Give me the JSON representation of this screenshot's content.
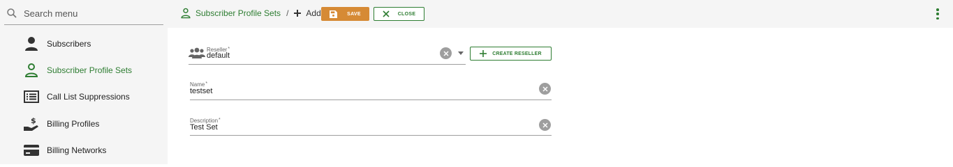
{
  "search": {
    "placeholder": "Search menu"
  },
  "sidebar": {
    "items": [
      {
        "label": "Subscribers",
        "icon": "person-icon",
        "active": false
      },
      {
        "label": "Subscriber Profile Sets",
        "icon": "person-outline-icon",
        "active": true
      },
      {
        "label": "Call List Suppressions",
        "icon": "list-icon",
        "active": false
      },
      {
        "label": "Billing Profiles",
        "icon": "hand-dollar-icon",
        "active": false
      },
      {
        "label": "Billing Networks",
        "icon": "credit-card-icon",
        "active": false
      }
    ]
  },
  "header": {
    "breadcrumb_link": "Subscriber Profile Sets",
    "separator": "/",
    "current": "Add",
    "save_label": "SAVE",
    "close_label": "CLOSE"
  },
  "form": {
    "reseller": {
      "label": "Reseller",
      "required": "*",
      "value": "default",
      "create_label": "CREATE RESELLER"
    },
    "name": {
      "label": "Name",
      "required": "*",
      "value": "testset"
    },
    "description": {
      "label": "Description",
      "required": "*",
      "value": "Test Set"
    }
  },
  "colors": {
    "accent": "#2e7d32",
    "save": "#d68a35",
    "sidebar_bg": "#f5f5f5",
    "clear_icon": "#9e9e9e"
  }
}
